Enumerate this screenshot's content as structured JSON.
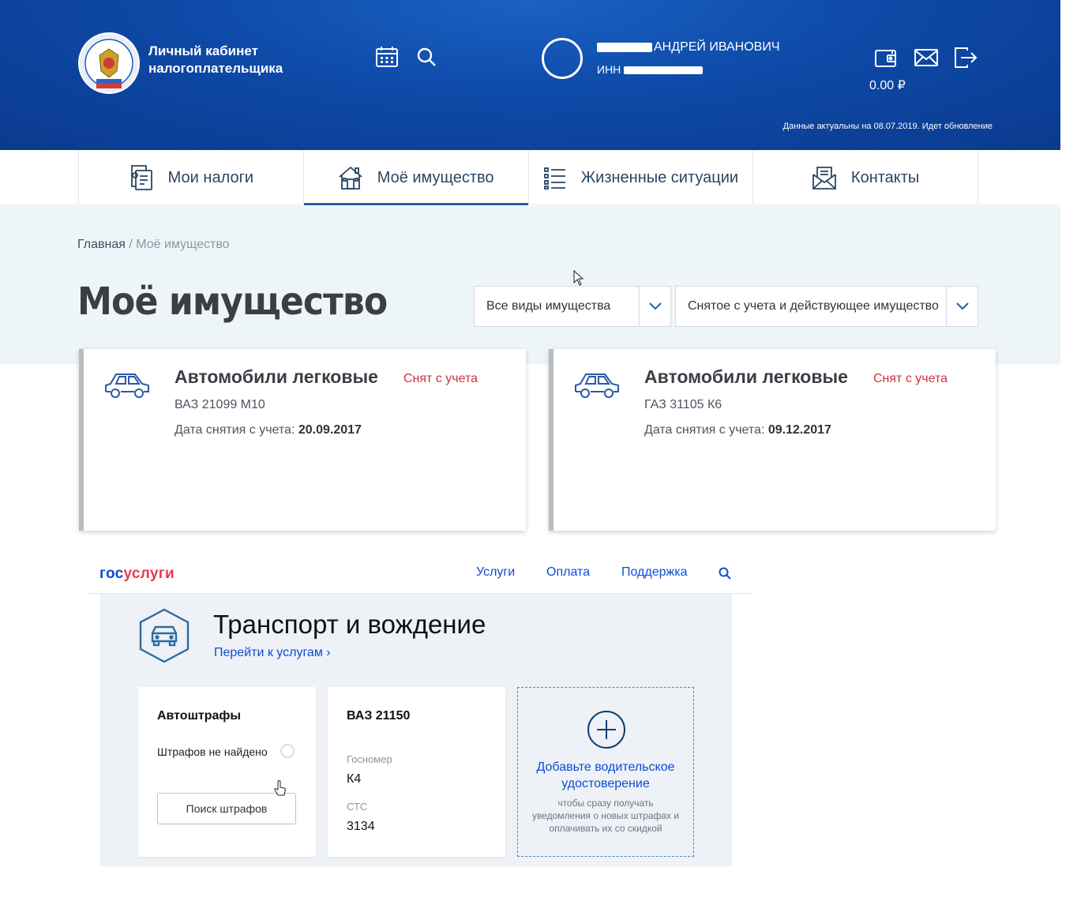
{
  "header": {
    "brand_line1": "Личный кабинет",
    "brand_line2": "налогоплательщика",
    "user_name": "АНДРЕЙ ИВАНОВИЧ",
    "inn_label": "ИНН",
    "balance": "0.00 ₽",
    "data_note": "Данные актуальны на 08.07.2019. Идет обновление"
  },
  "nav": {
    "tabs": [
      {
        "label": "Мои налоги"
      },
      {
        "label": "Моё имущество"
      },
      {
        "label": "Жизненные ситуации"
      },
      {
        "label": "Контакты"
      }
    ]
  },
  "breadcrumb": {
    "home": "Главная",
    "separator": " / ",
    "current": "Моё имущество"
  },
  "page": {
    "title": "Моё имущество",
    "filter_type": "Все виды имущества",
    "filter_status": "Снятое с учета и действующее имущество"
  },
  "properties": [
    {
      "title": "Автомобили легковые",
      "status": "Снят с учета",
      "model": "ВАЗ 21099 М10",
      "date_label": "Дата снятия с учета: ",
      "date_value": "20.09.2017"
    },
    {
      "title": "Автомобили легковые",
      "status": "Снят с учета",
      "model": "ГАЗ 31105 К6",
      "date_label": "Дата снятия с учета: ",
      "date_value": "09.12.2017"
    }
  ],
  "gosuslugi": {
    "logo_part1": "гос",
    "logo_part2": "услуги",
    "nav": [
      "Услуги",
      "Оплата",
      "Поддержка"
    ],
    "section_title": "Транспорт и вождение",
    "section_link": "Перейти к услугам",
    "fines_card": {
      "title": "Автоштрафы",
      "status": "Штрафов не найдено",
      "button": "Поиск штрафов"
    },
    "vehicle_card": {
      "title": "ВАЗ 21150",
      "plate_label": "Госномер",
      "plate_value": "К4",
      "sts_label": "СТС",
      "sts_value": "3134"
    },
    "add_card": {
      "title": "Добавьте водительское удостоверение",
      "description": "чтобы сразу получать уведомления о новых штрафах и оплачивать их со скидкой"
    }
  }
}
